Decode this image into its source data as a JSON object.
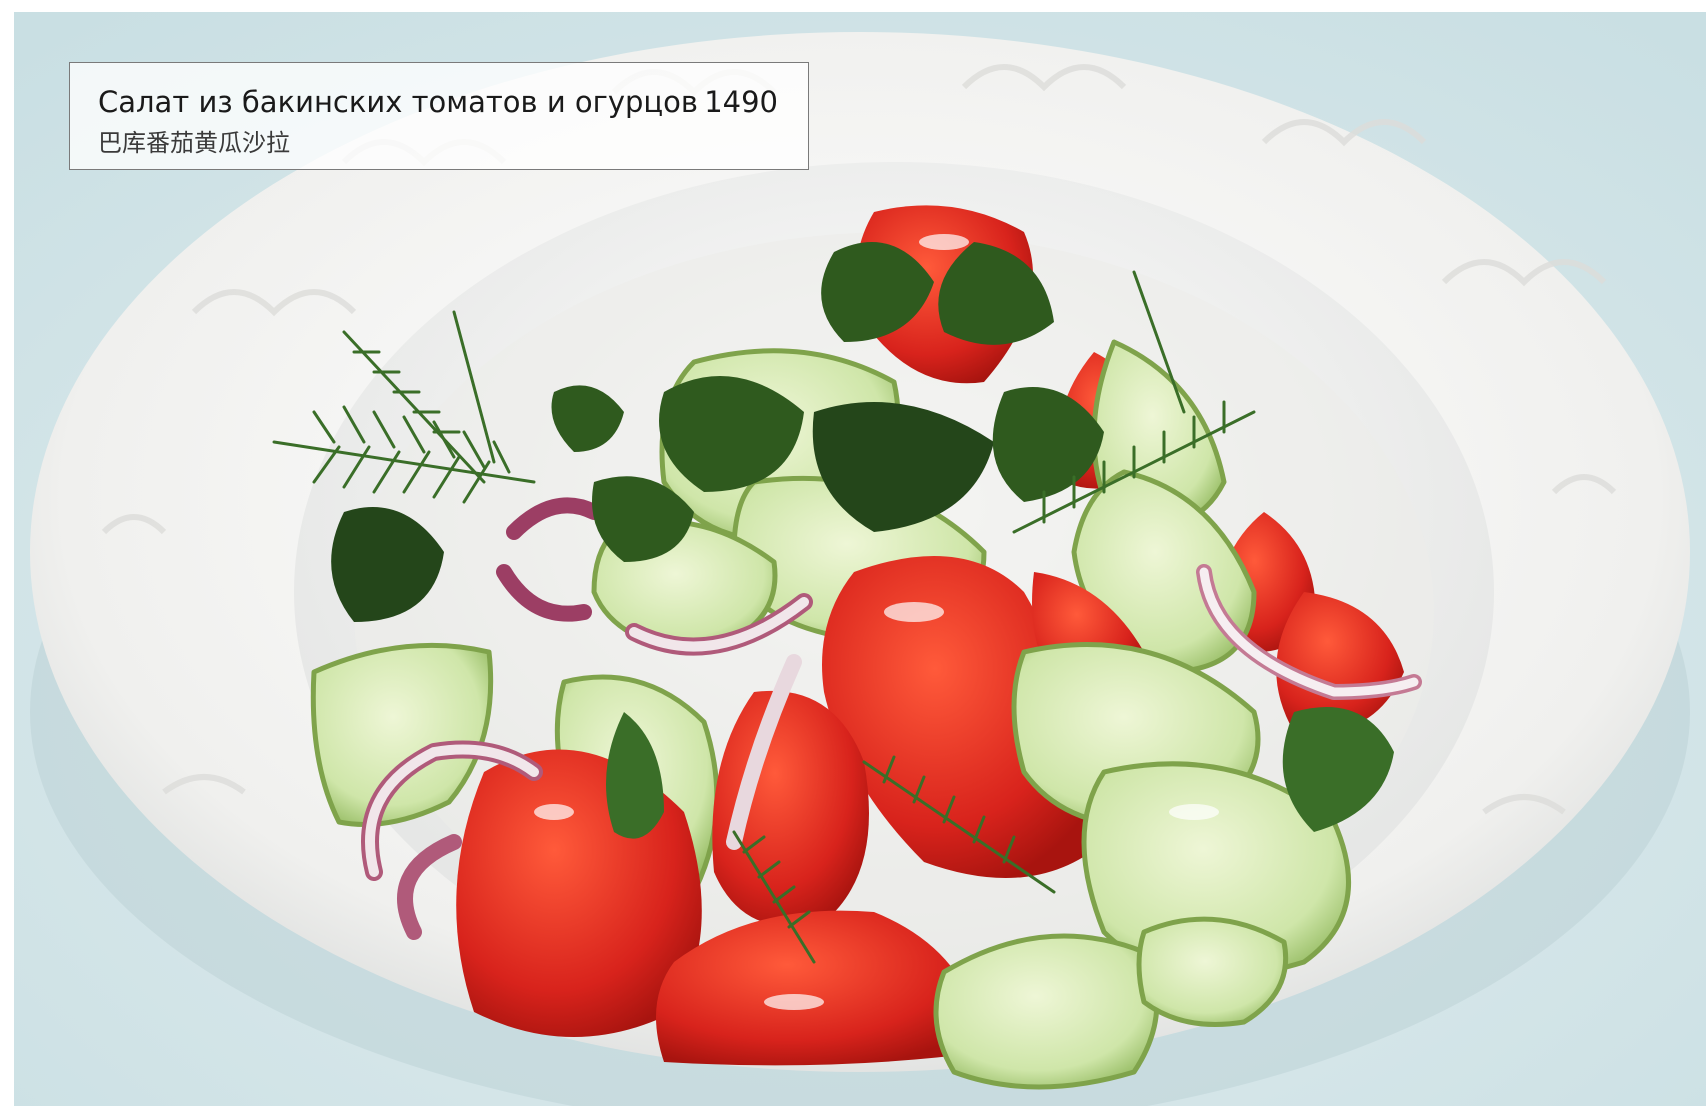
{
  "menu_item": {
    "name_ru": "Салат из бакинских томатов и огурцов",
    "price": "1490",
    "name_zh": "巴库番茄黄瓜沙拉"
  },
  "colors": {
    "background": "#d9e8eb",
    "bowl": "#f3f3f1",
    "tomato": "#d8231c",
    "cucumber": "#cfe6a9",
    "herb": "#2f5a1e",
    "onion": "#b05a7a"
  }
}
